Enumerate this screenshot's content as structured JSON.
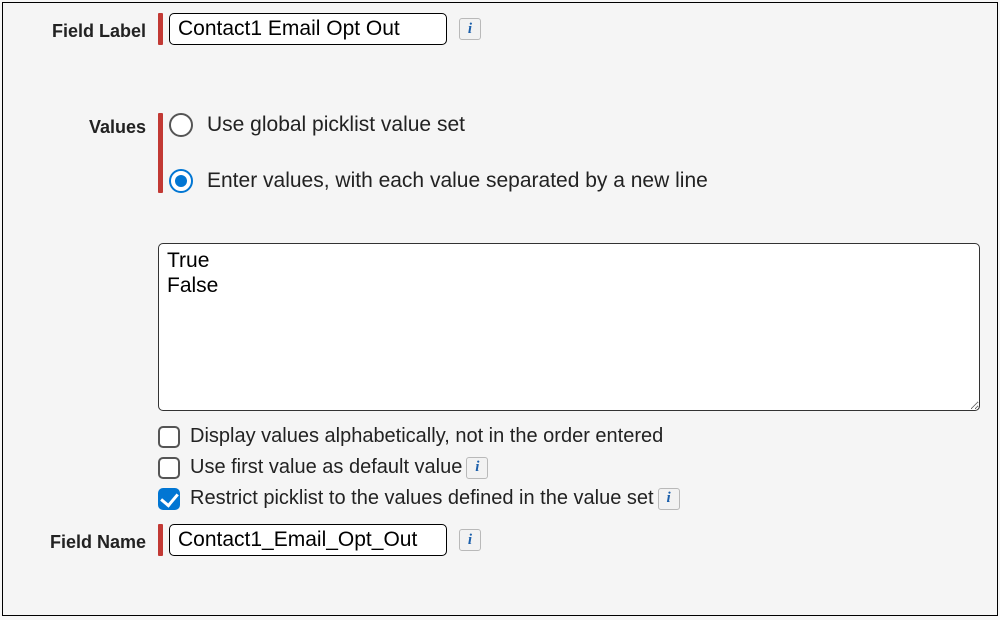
{
  "fieldLabel": {
    "label": "Field Label",
    "value": "Contact1 Email Opt Out"
  },
  "values": {
    "label": "Values",
    "options": {
      "global": "Use global picklist value set",
      "manual": "Enter values, with each value separated by a new line"
    },
    "selected": "manual",
    "textarea": "True\nFalse",
    "checkboxes": {
      "alpha": {
        "label": "Display values alphabetically, not in the order entered",
        "checked": false
      },
      "first": {
        "label": "Use first value as default value",
        "checked": false
      },
      "restrict": {
        "label": "Restrict picklist to the values defined in the value set",
        "checked": true
      }
    }
  },
  "fieldName": {
    "label": "Field Name",
    "value": "Contact1_Email_Opt_Out"
  },
  "icons": {
    "info": "i"
  }
}
